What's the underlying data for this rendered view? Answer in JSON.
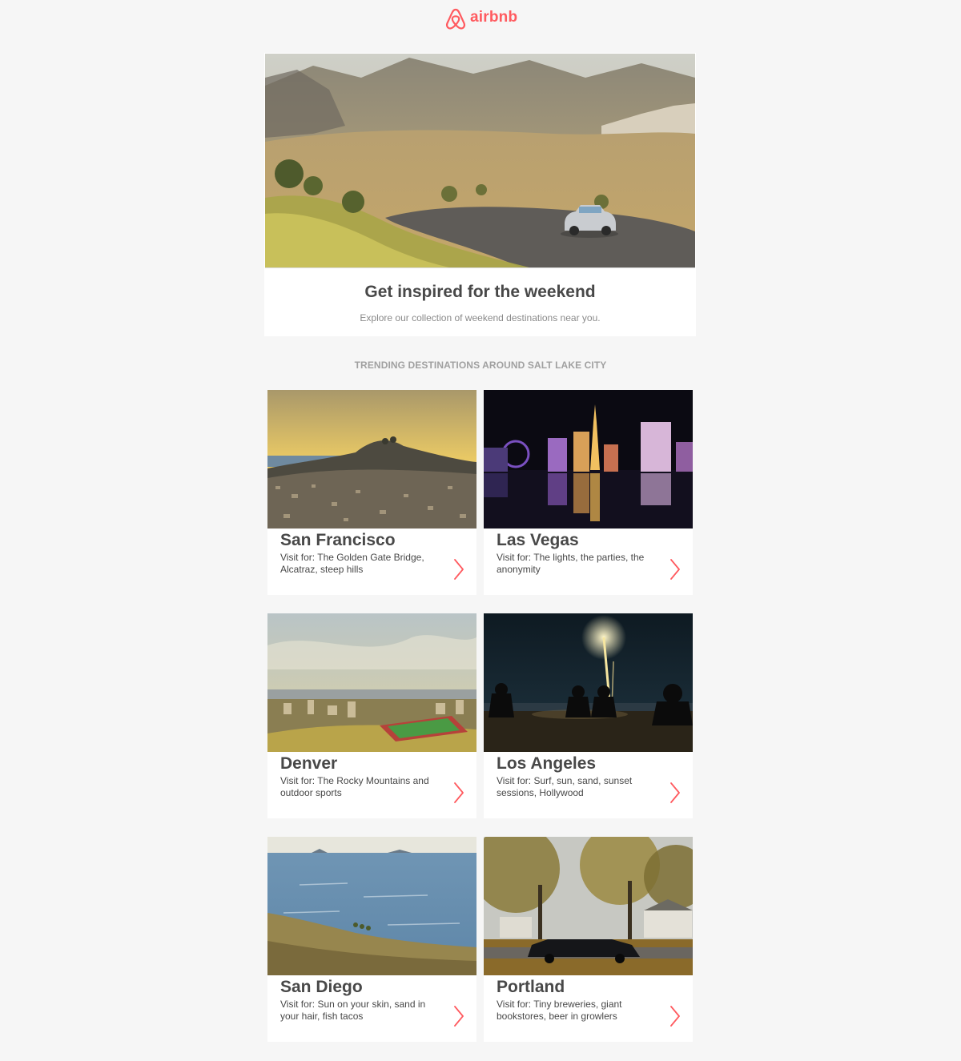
{
  "brand": {
    "name": "airbnb",
    "color": "#ff5a5f"
  },
  "hero": {
    "image_icon": "desert-road-convertible-image",
    "title": "Get inspired for the weekend",
    "subtitle": "Explore our collection of weekend destinations near you."
  },
  "section": {
    "title": "TRENDING DESTINATIONS AROUND SALT LAKE CITY"
  },
  "destinations": [
    {
      "name": "San Francisco",
      "description": "Visit for: The Golden Gate Bridge, Alcatraz, steep hills",
      "image_icon": "san-francisco-hill-image"
    },
    {
      "name": "Las Vegas",
      "description": "Visit for: The lights, the parties, the anonymity",
      "image_icon": "las-vegas-night-image"
    },
    {
      "name": "Denver",
      "description": "Visit for: The Rocky Mountains and outdoor sports",
      "image_icon": "denver-cityscape-image"
    },
    {
      "name": "Los Angeles",
      "description": "Visit for: Surf, sun, sand, sunset sessions, Hollywood",
      "image_icon": "los-angeles-fireworks-image"
    },
    {
      "name": "San Diego",
      "description": "Visit for: Sun on your skin, sand in your hair, fish tacos",
      "image_icon": "san-diego-coast-image"
    },
    {
      "name": "Portland",
      "description": "Visit for: Tiny breweries, giant bookstores, beer in growlers",
      "image_icon": "portland-autumn-street-image"
    }
  ],
  "arrow_icon": "chevron-right-icon"
}
